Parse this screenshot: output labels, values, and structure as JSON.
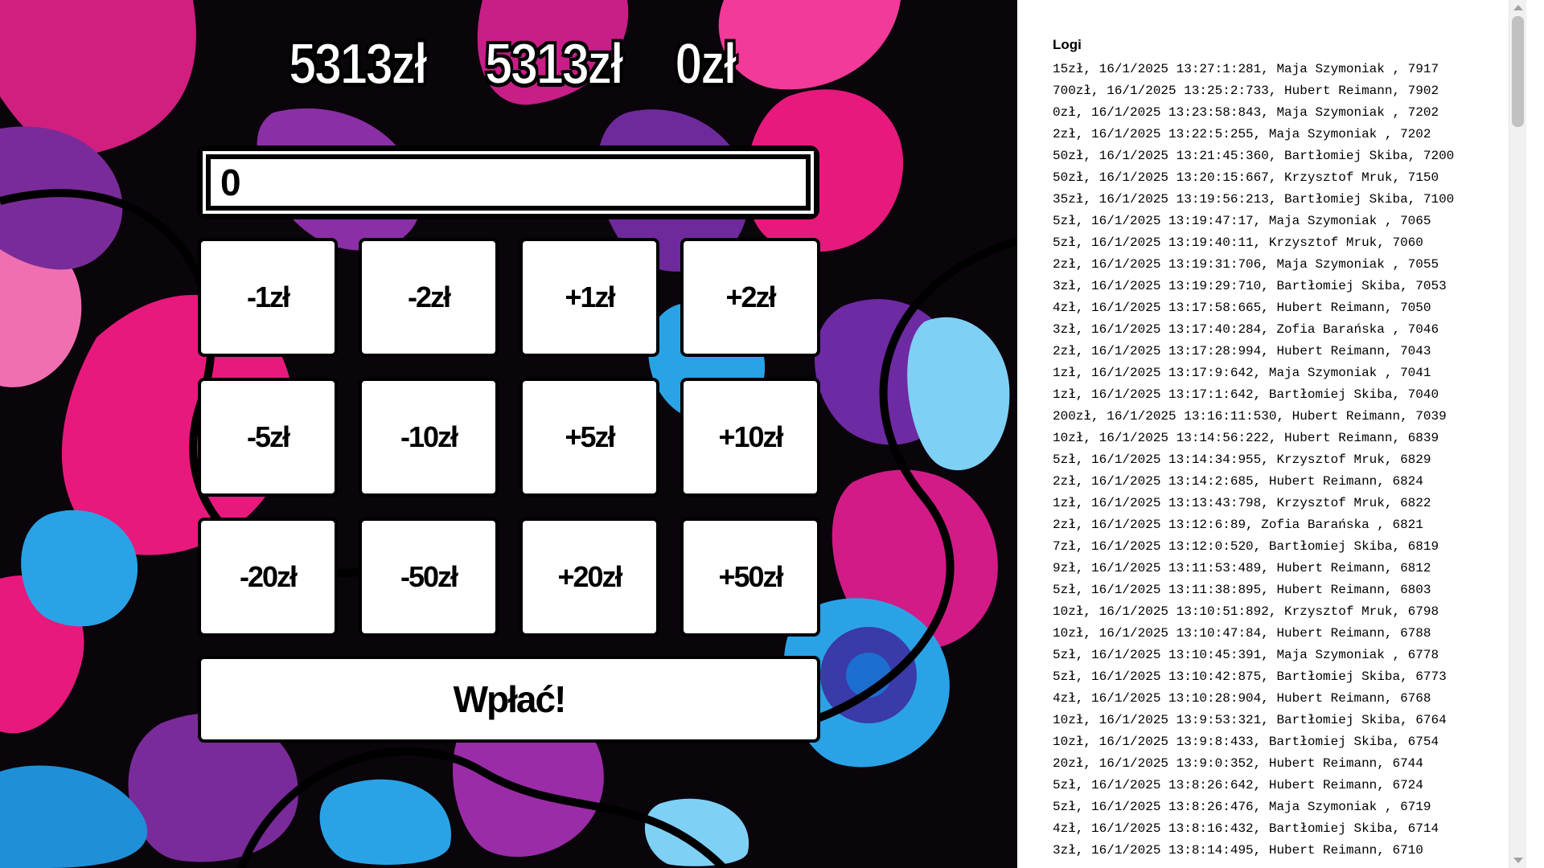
{
  "totals": [
    "5313zł",
    "5313zł",
    "0zł"
  ],
  "amount_input": {
    "value": "0"
  },
  "buttons": [
    "-1zł",
    "-2zł",
    "+1zł",
    "+2zł",
    "-5zł",
    "-10zł",
    "+5zł",
    "+10zł",
    "-20zł",
    "-50zł",
    "+20zł",
    "+50zł"
  ],
  "pay_button": "Wpłać!",
  "logs": {
    "title": "Logi",
    "entries": [
      "15zł, 16/1/2025 13:27:1:281, Maja Szymoniak , 7917",
      "700zł, 16/1/2025 13:25:2:733, Hubert Reimann, 7902",
      "0zł, 16/1/2025 13:23:58:843, Maja Szymoniak , 7202",
      "2zł, 16/1/2025 13:22:5:255, Maja Szymoniak , 7202",
      "50zł, 16/1/2025 13:21:45:360, Bartłomiej Skiba, 7200",
      "50zł, 16/1/2025 13:20:15:667, Krzysztof Mruk, 7150",
      "35zł, 16/1/2025 13:19:56:213, Bartłomiej Skiba, 7100",
      "5zł, 16/1/2025 13:19:47:17, Maja Szymoniak , 7065",
      "5zł, 16/1/2025 13:19:40:11, Krzysztof Mruk, 7060",
      "2zł, 16/1/2025 13:19:31:706, Maja Szymoniak , 7055",
      "3zł, 16/1/2025 13:19:29:710, Bartłomiej Skiba, 7053",
      "4zł, 16/1/2025 13:17:58:665, Hubert Reimann, 7050",
      "3zł, 16/1/2025 13:17:40:284, Zofia Barańska , 7046",
      "2zł, 16/1/2025 13:17:28:994, Hubert Reimann, 7043",
      "1zł, 16/1/2025 13:17:9:642, Maja Szymoniak , 7041",
      "1zł, 16/1/2025 13:17:1:642, Bartłomiej Skiba, 7040",
      "200zł, 16/1/2025 13:16:11:530, Hubert Reimann, 7039",
      "10zł, 16/1/2025 13:14:56:222, Hubert Reimann, 6839",
      "5zł, 16/1/2025 13:14:34:955, Krzysztof Mruk, 6829",
      "2zł, 16/1/2025 13:14:2:685, Hubert Reimann, 6824",
      "1zł, 16/1/2025 13:13:43:798, Krzysztof Mruk, 6822",
      "2zł, 16/1/2025 13:12:6:89, Zofia Barańska , 6821",
      "7zł, 16/1/2025 13:12:0:520, Bartłomiej Skiba, 6819",
      "9zł, 16/1/2025 13:11:53:489, Hubert Reimann, 6812",
      "5zł, 16/1/2025 13:11:38:895, Hubert Reimann, 6803",
      "10zł, 16/1/2025 13:10:51:892, Krzysztof Mruk, 6798",
      "10zł, 16/1/2025 13:10:47:84, Hubert Reimann, 6788",
      "5zł, 16/1/2025 13:10:45:391, Maja Szymoniak , 6778",
      "5zł, 16/1/2025 13:10:42:875, Bartłomiej Skiba, 6773",
      "4zł, 16/1/2025 13:10:28:904, Hubert Reimann, 6768",
      "10zł, 16/1/2025 13:9:53:321, Bartłomiej Skiba, 6764",
      "10zł, 16/1/2025 13:9:8:433, Bartłomiej Skiba, 6754",
      "20zł, 16/1/2025 13:9:0:352, Hubert Reimann, 6744",
      "5zł, 16/1/2025 13:8:26:642, Hubert Reimann, 6724",
      "5zł, 16/1/2025 13:8:26:476, Maja Szymoniak , 6719",
      "4zł, 16/1/2025 13:8:16:432, Bartłomiej Skiba, 6714",
      "3zł, 16/1/2025 13:8:14:495, Hubert Reimann, 6710"
    ]
  },
  "colors": {
    "pattern_magenta": "#e8197d",
    "pattern_purple": "#7a2b9a",
    "pattern_blue": "#2aa3e6",
    "pattern_dark": "#080308"
  }
}
